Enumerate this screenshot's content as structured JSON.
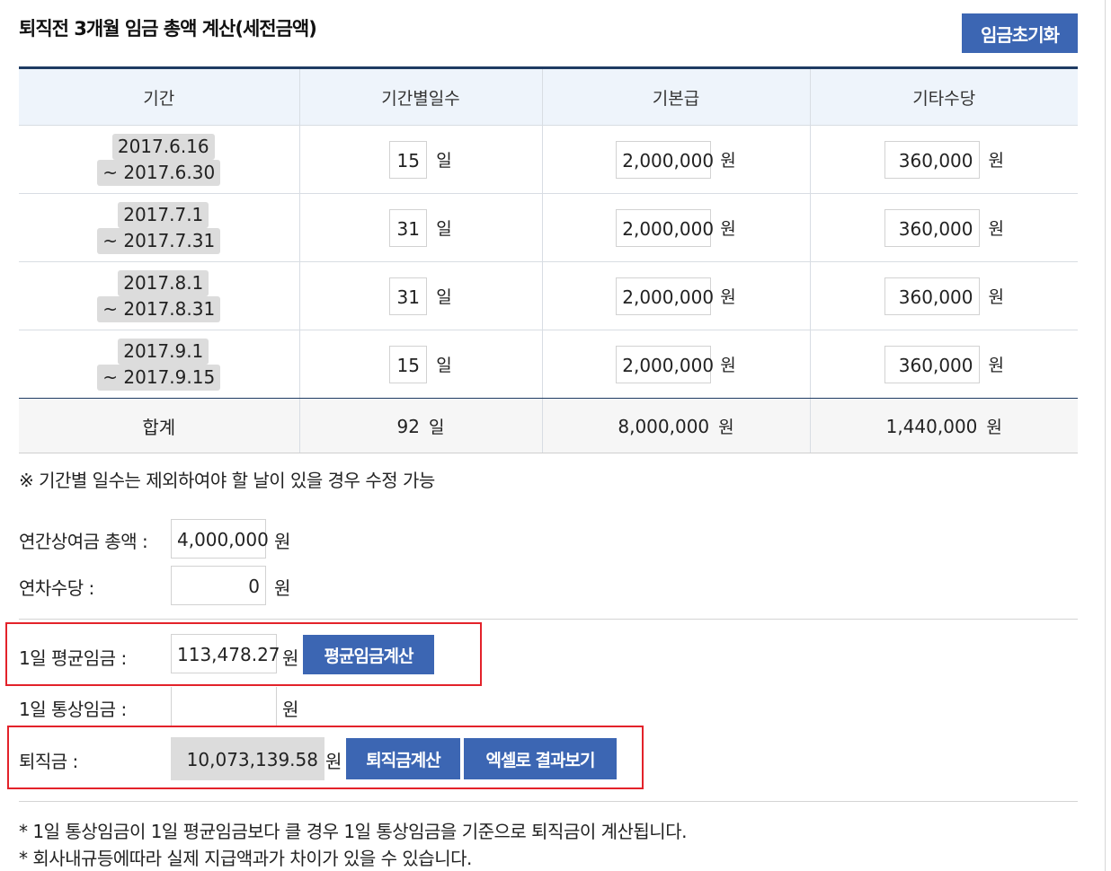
{
  "title": "퇴직전 3개월 임금 총액 계산(세전금액)",
  "reset_button": "임금초기화",
  "table": {
    "headers": [
      "기간",
      "기간별일수",
      "기본급",
      "기타수당"
    ],
    "rows": [
      {
        "start": "2017.6.16",
        "end": "~ 2017.6.30",
        "days": "15",
        "days_unit": "일",
        "base": "2,000,000",
        "base_unit": "원",
        "allowance": "360,000",
        "allowance_unit": "원"
      },
      {
        "start": "2017.7.1",
        "end": "~ 2017.7.31",
        "days": "31",
        "days_unit": "일",
        "base": "2,000,000",
        "base_unit": "원",
        "allowance": "360,000",
        "allowance_unit": "원"
      },
      {
        "start": "2017.8.1",
        "end": "~ 2017.8.31",
        "days": "31",
        "days_unit": "일",
        "base": "2,000,000",
        "base_unit": "원",
        "allowance": "360,000",
        "allowance_unit": "원"
      },
      {
        "start": "2017.9.1",
        "end": "~ 2017.9.15",
        "days": "15",
        "days_unit": "일",
        "base": "2,000,000",
        "base_unit": "원",
        "allowance": "360,000",
        "allowance_unit": "원"
      }
    ],
    "total": {
      "label": "합계",
      "days": "92",
      "days_unit": "일",
      "base": "8,000,000",
      "base_unit": "원",
      "allowance": "1,440,000",
      "allowance_unit": "원"
    }
  },
  "note": "※ 기간별 일수는 제외하여야 할 날이 있을 경우 수정 가능",
  "annual_bonus": {
    "label": "연간상여금 총액 :",
    "value": "4,000,000",
    "unit": "원"
  },
  "annual_leave": {
    "label": "연차수당 :",
    "value": "0",
    "unit": "원"
  },
  "daily_avg": {
    "label": "1일 평균임금 :",
    "value": "113,478.27",
    "unit": "원",
    "button": "평균임금계산"
  },
  "daily_ordinary": {
    "label": "1일 통상임금 :",
    "value": "",
    "unit": "원"
  },
  "severance": {
    "label": "퇴직금 :",
    "value": "10,073,139.58",
    "unit": "원",
    "calc_button": "퇴직금계산",
    "excel_button": "엑셀로 결과보기"
  },
  "footnotes": [
    "* 1일 통상임금이 1일 평균임금보다 클 경우 1일 통상임금을 기준으로 퇴직금이 계산됩니다.",
    "* 회사내규등에따라 실제 지급액과가 차이가 있을 수 있습니다."
  ],
  "colors": {
    "accent": "#3c66b3",
    "highlight": "#e3222a",
    "header_bg": "#eef4fb"
  }
}
